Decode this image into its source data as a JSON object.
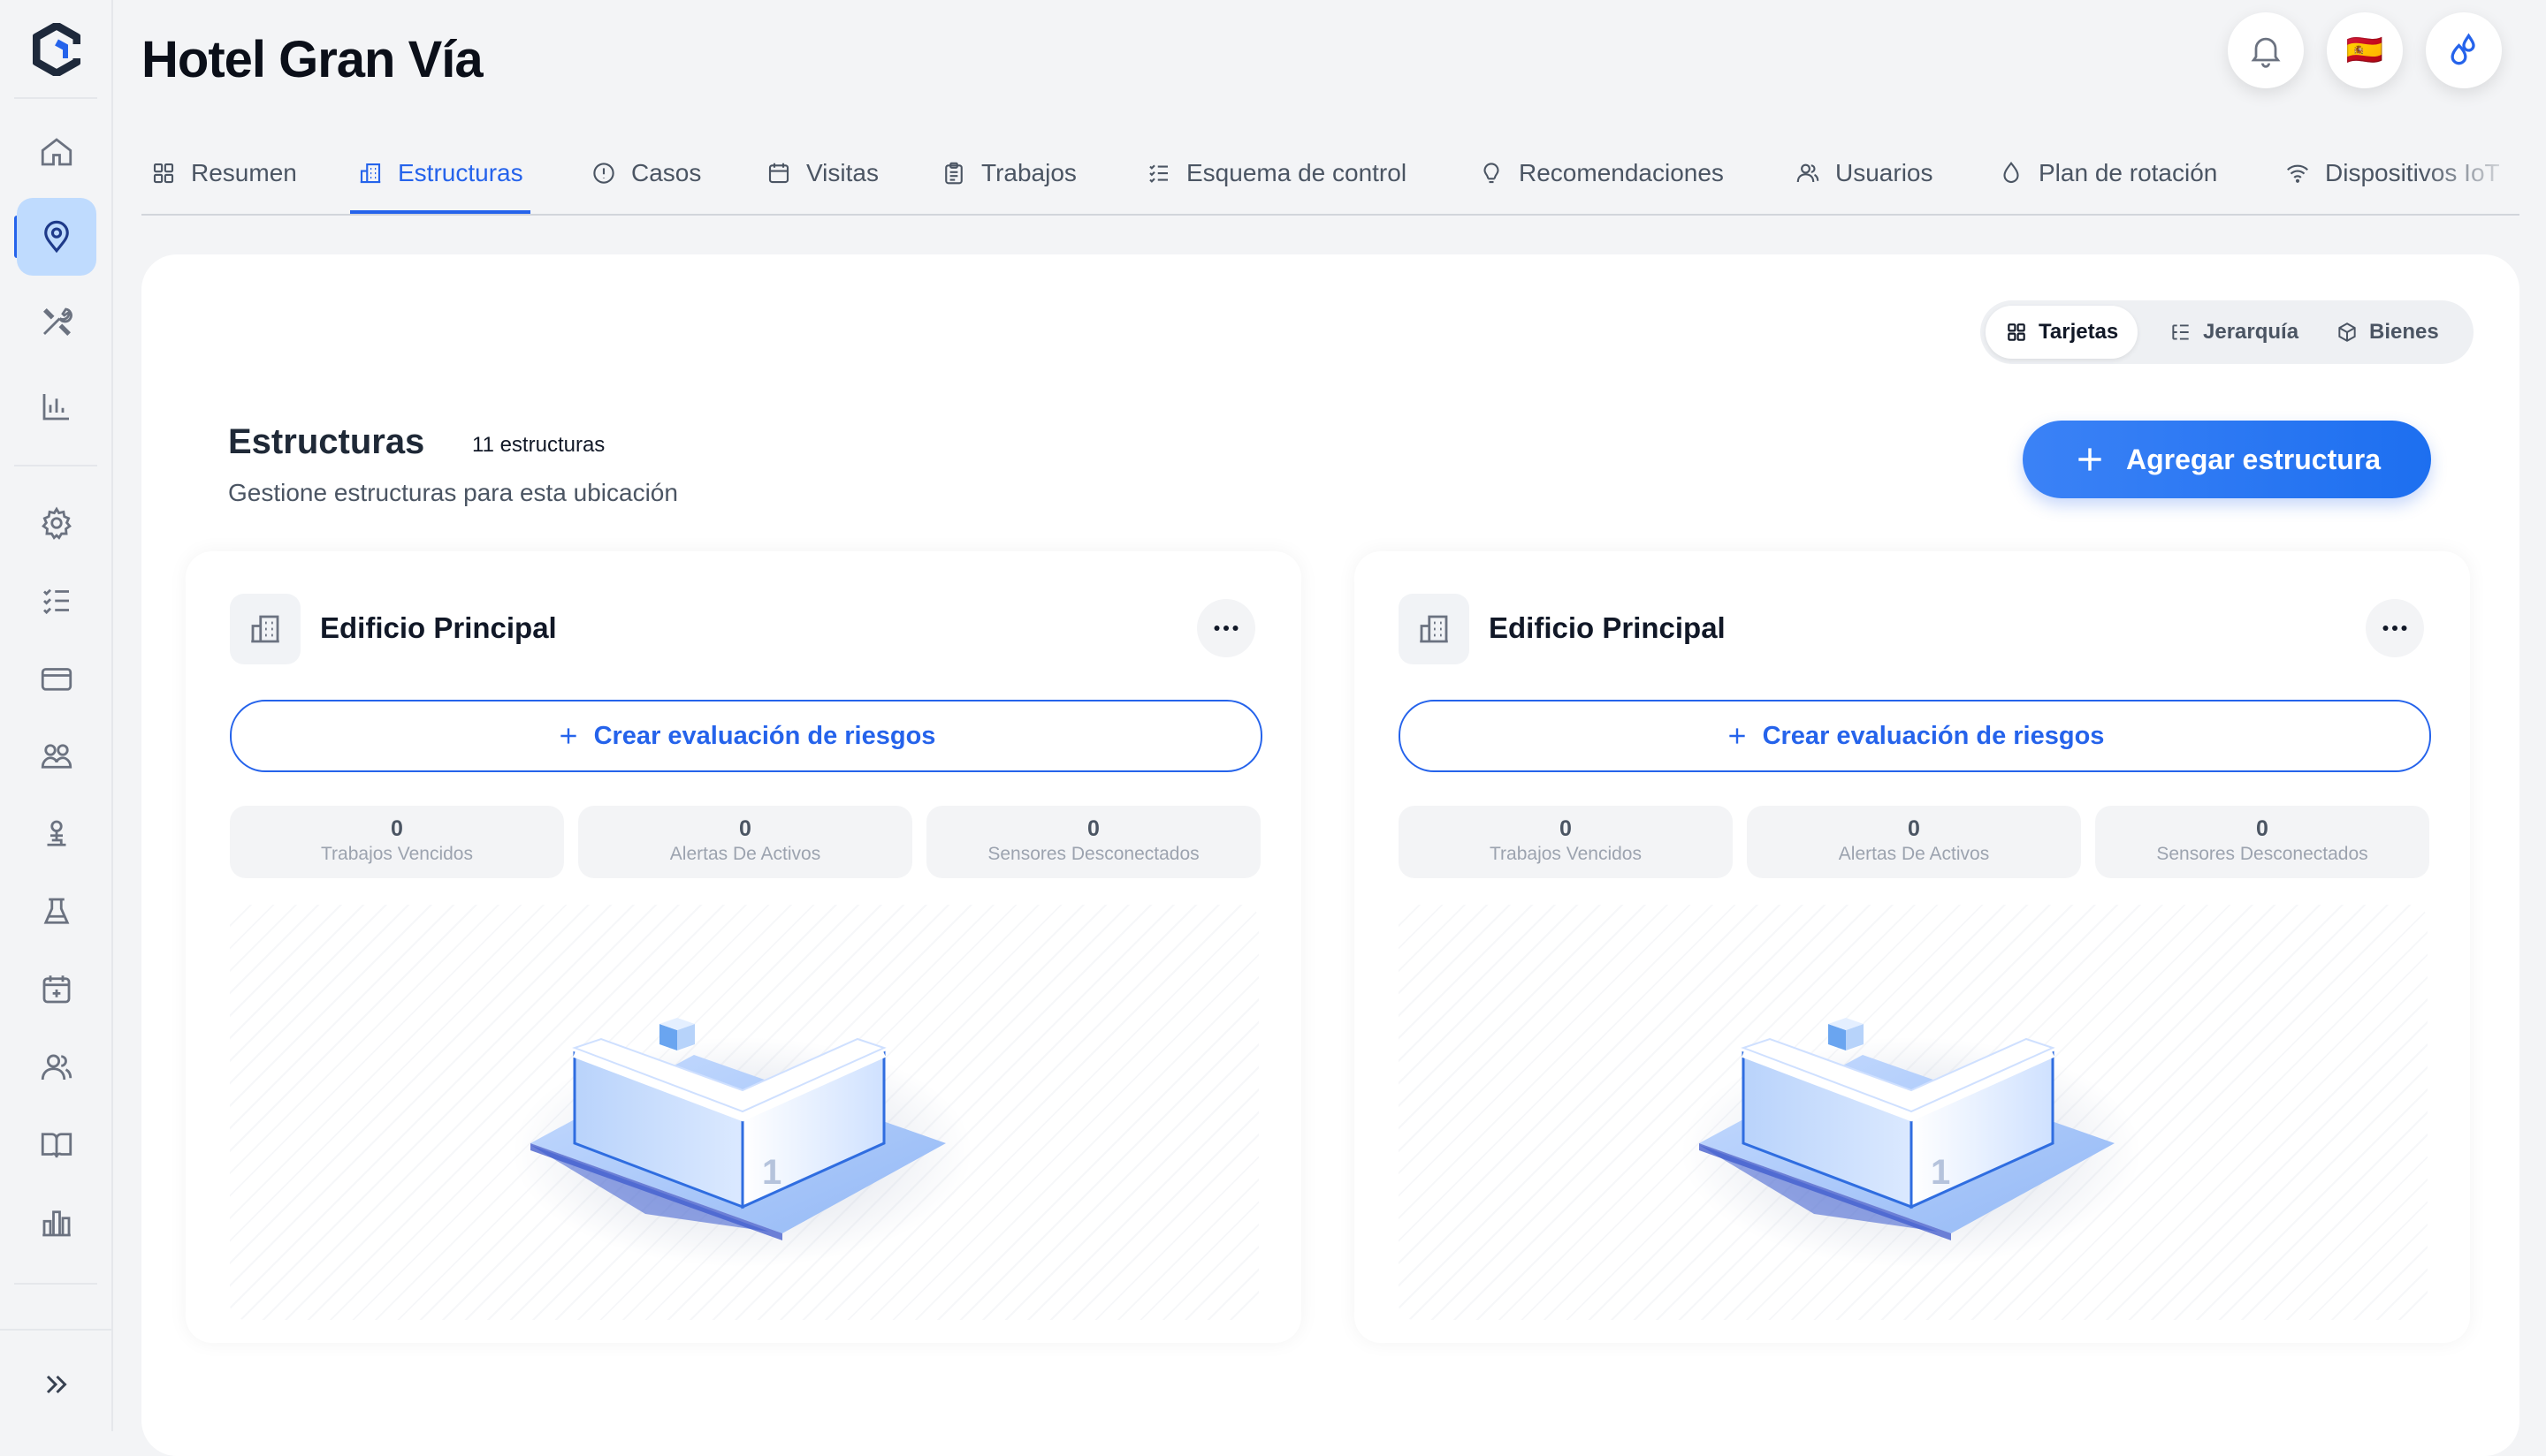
{
  "app": {
    "page_title": "Hotel Gran Vía"
  },
  "header": {
    "notifications_icon": "bell-icon",
    "language_flag": "🇪🇸",
    "brand_icon": "water-drops-icon"
  },
  "sidebar": {
    "items": [
      {
        "name": "home",
        "icon": "home-icon"
      },
      {
        "name": "locations",
        "icon": "map-pin-icon",
        "active": true
      },
      {
        "name": "tools",
        "icon": "tools-icon"
      },
      {
        "name": "analytics",
        "icon": "bar-chart-icon"
      },
      {
        "name": "settings",
        "icon": "gear-icon"
      },
      {
        "name": "checklists",
        "icon": "checklist-icon"
      },
      {
        "name": "billing",
        "icon": "credit-card-icon"
      },
      {
        "name": "teams",
        "icon": "group-icon"
      },
      {
        "name": "sampling",
        "icon": "tap-icon"
      },
      {
        "name": "laboratory",
        "icon": "flask-icon"
      },
      {
        "name": "calendar",
        "icon": "calendar-plus-icon"
      },
      {
        "name": "users",
        "icon": "users-icon"
      },
      {
        "name": "library",
        "icon": "book-icon"
      },
      {
        "name": "reports",
        "icon": "buildings-chart-icon"
      }
    ],
    "expand_icon": "chevrons-right-icon"
  },
  "tabs": [
    {
      "label": "Resumen",
      "icon": "grid-icon"
    },
    {
      "label": "Estructuras",
      "icon": "building-icon",
      "active": true
    },
    {
      "label": "Casos",
      "icon": "alert-circle-icon"
    },
    {
      "label": "Visitas",
      "icon": "calendar-icon"
    },
    {
      "label": "Trabajos",
      "icon": "clipboard-icon"
    },
    {
      "label": "Esquema de control",
      "icon": "list-check-icon"
    },
    {
      "label": "Recomendaciones",
      "icon": "lightbulb-icon"
    },
    {
      "label": "Usuarios",
      "icon": "users-icon"
    },
    {
      "label": "Plan de rotación",
      "icon": "drop-icon"
    },
    {
      "label": "Dispositivos IoT",
      "icon": "wifi-icon"
    }
  ],
  "view_switch": {
    "options": [
      {
        "label": "Tarjetas",
        "icon": "grid-icon",
        "active": true
      },
      {
        "label": "Jerarquía",
        "icon": "hierarchy-icon"
      },
      {
        "label": "Bienes",
        "icon": "box-icon"
      }
    ]
  },
  "section": {
    "title": "Estructuras",
    "count": "11 estructuras",
    "subtitle": "Gestione estructuras para esta ubicación",
    "add_button": "Agregar estructura"
  },
  "cards": [
    {
      "title": "Edificio Principal",
      "risk_button": "Crear evaluación de riesgos",
      "stats": [
        {
          "value": "0",
          "label": "Trabajos Vencidos"
        },
        {
          "value": "0",
          "label": "Alertas De Activos"
        },
        {
          "value": "0",
          "label": "Sensores Desconectados"
        }
      ],
      "floor_number": "1"
    },
    {
      "title": "Edificio Principal",
      "risk_button": "Crear evaluación de riesgos",
      "stats": [
        {
          "value": "0",
          "label": "Trabajos Vencidos"
        },
        {
          "value": "0",
          "label": "Alertas De Activos"
        },
        {
          "value": "0",
          "label": "Sensores Desconectados"
        }
      ],
      "floor_number": "1"
    }
  ],
  "colors": {
    "accent": "#2563eb",
    "sidebar_active": "#bfdbfe",
    "background": "#f3f4f6"
  }
}
